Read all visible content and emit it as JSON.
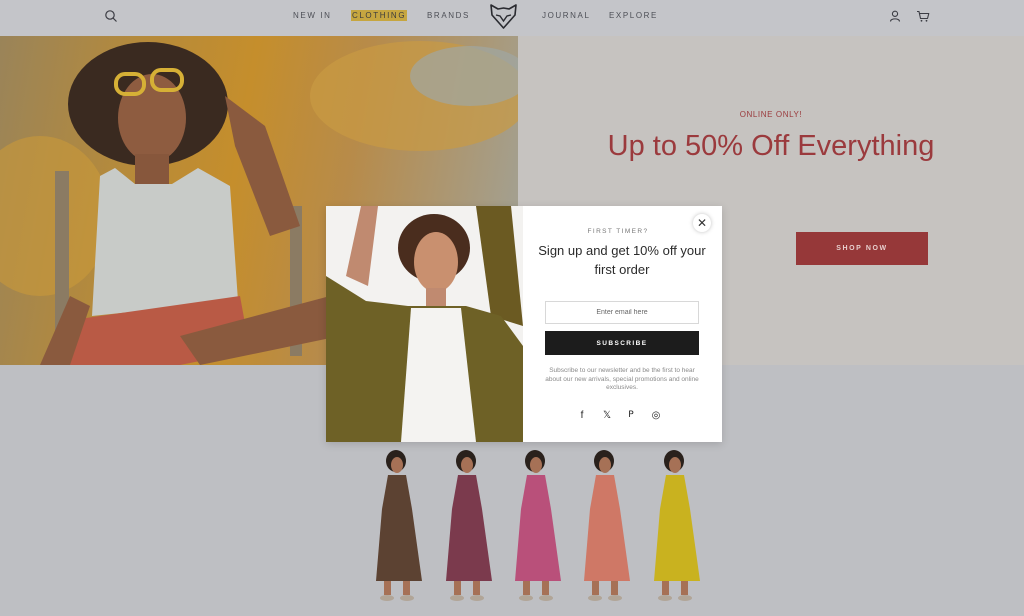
{
  "header": {
    "nav": [
      {
        "label": "NEW IN"
      },
      {
        "label": "CLOTHING",
        "active": true
      },
      {
        "label": "BRANDS"
      },
      {
        "label": "JOURNAL"
      },
      {
        "label": "EXPLORE"
      }
    ],
    "icons": [
      "search-icon",
      "fox-logo",
      "account-icon",
      "cart-icon"
    ]
  },
  "hero": {
    "promo_label": "ONLINE ONLY!",
    "promo_title": "Up to 50% Off Everything",
    "cta": "SHOP NOW"
  },
  "products": {
    "dress_colors": [
      "#5c4232",
      "#7b3a4d",
      "#b9507a",
      "#cf7866",
      "#c9b21f"
    ]
  },
  "modal": {
    "eyebrow": "FIRST TIMER?",
    "title": "Sign up and get 10% off your first order",
    "email_placeholder": "Enter email here",
    "subscribe": "SUBSCRIBE",
    "description": "Subscribe to our newsletter and be the first to hear about our new arrivals, special promotions and online exclusives.",
    "social": [
      {
        "name": "facebook-icon",
        "glyph": "f"
      },
      {
        "name": "x-icon",
        "glyph": "𝕏"
      },
      {
        "name": "pinterest-icon",
        "glyph": "P"
      },
      {
        "name": "instagram-icon",
        "glyph": "◎"
      }
    ]
  },
  "colors": {
    "accent": "#9b3a3d",
    "button_dark": "#1c1c1c",
    "nav_highlight": "#c6a640"
  }
}
